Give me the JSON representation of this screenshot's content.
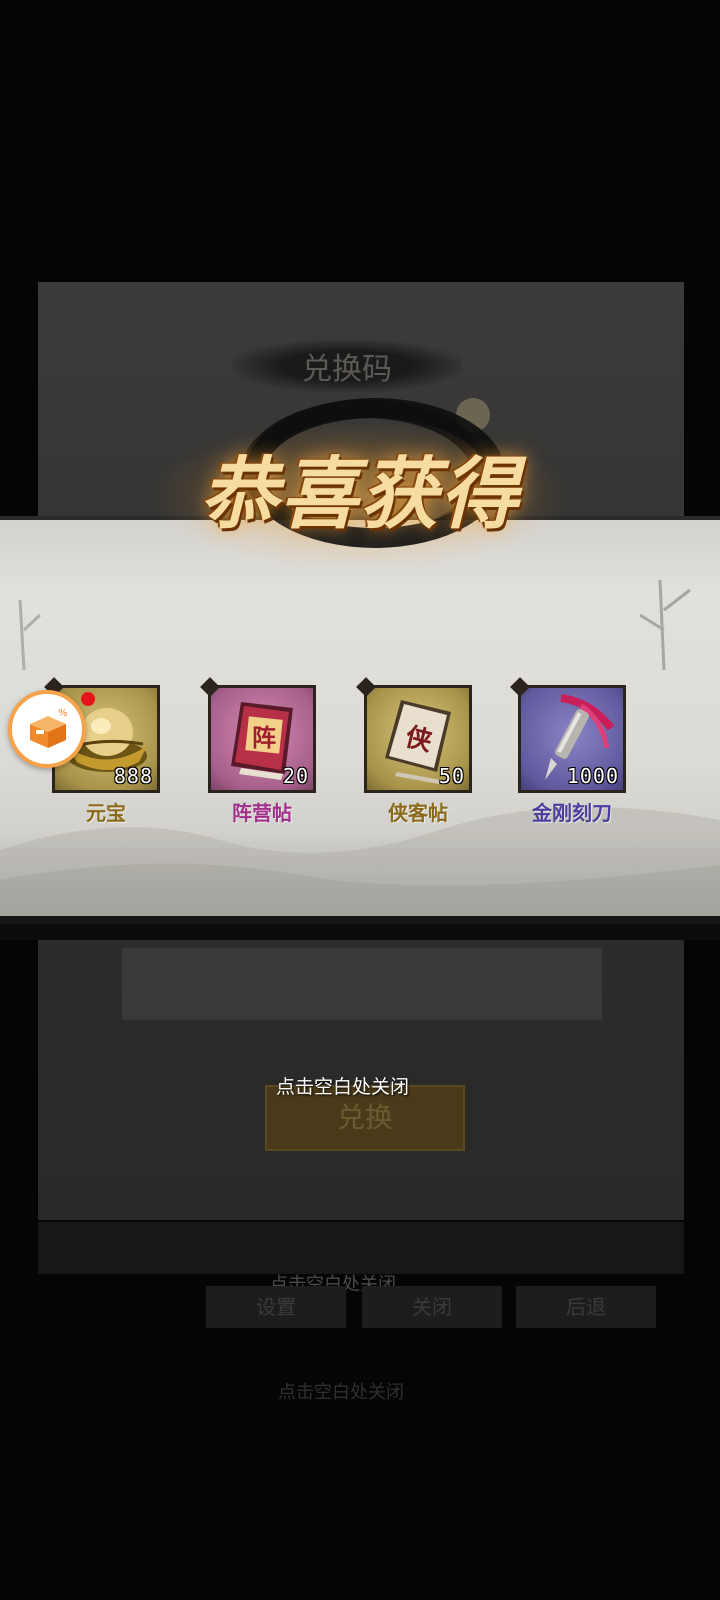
{
  "background": {
    "title": "兑换码",
    "redeem_button": "兑换",
    "hint_secondary": "点击空白处关闭",
    "tabs": [
      "设置",
      "关闭",
      "后退"
    ],
    "hint_tertiary": "点击空白处关闭"
  },
  "popup": {
    "title": "恭喜获得",
    "rewards": [
      {
        "name": "元宝",
        "count": "888",
        "name_color": "#8a6a1c",
        "has_red_dot": true,
        "icon": "gold-ingot-icon"
      },
      {
        "name": "阵营帖",
        "count": "20",
        "name_color": "#a0308a",
        "has_red_dot": false,
        "icon": "camp-card-icon"
      },
      {
        "name": "侠客帖",
        "count": "50",
        "name_color": "#8a6a1c",
        "has_red_dot": false,
        "icon": "hero-card-icon"
      },
      {
        "name": "金刚刻刀",
        "count": "1000",
        "name_color": "#4b3e9c",
        "has_red_dot": false,
        "icon": "carving-knife-icon"
      }
    ],
    "close_hint": "点击空白处关闭"
  },
  "floating_button": {
    "icon": "assistant-box-icon",
    "color": "#f6a24a"
  }
}
